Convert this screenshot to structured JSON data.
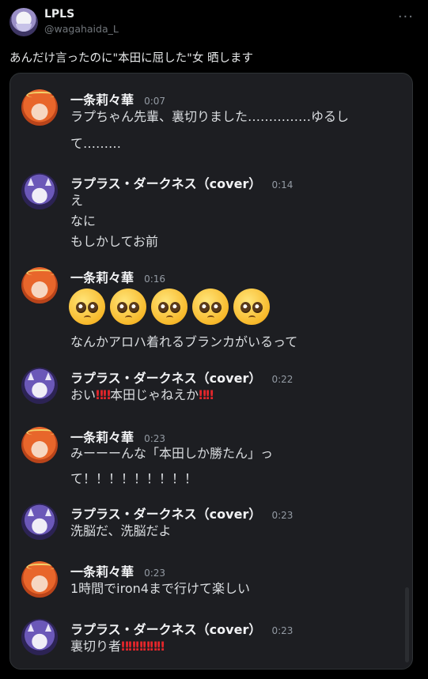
{
  "tweet": {
    "display_name": "LPLS",
    "handle": "@wagahaida_L",
    "text": "あんだけ言ったのに\"本田に屈した\"女 晒します",
    "more_icon": "more-horizontal-icon"
  },
  "chat": {
    "messages": [
      {
        "user": "一条莉々華",
        "time": "0:07",
        "avatar": "ichijou",
        "lines": [
          "ラプちゃん先輩、裏切りました……………ゆるし",
          "て………"
        ]
      },
      {
        "user": "ラプラス・ダークネス（cover）",
        "time": "0:14",
        "avatar": "laplus",
        "lines": [
          "え",
          "なに",
          "もしかしてお前"
        ]
      },
      {
        "user": "一条莉々華",
        "time": "0:16",
        "avatar": "ichijou",
        "emoji": "pleading-face-icon",
        "emoji_count": 5,
        "lines": [
          "なんかアロハ着れるブランカがいるって"
        ]
      },
      {
        "user": "ラプラス・ダークネス（cover）",
        "time": "0:22",
        "avatar": "laplus",
        "text_a": "おい",
        "bang_a": "‼‼",
        "text_b": "本田じゃねえか",
        "bang_b": "‼‼"
      },
      {
        "user": "一条莉々華",
        "time": "0:23",
        "avatar": "ichijou",
        "lines": [
          "みーーーんな「本田しか勝たん」っ",
          "て！！！！！！！！！"
        ]
      },
      {
        "user": "ラプラス・ダークネス（cover）",
        "time": "0:23",
        "avatar": "laplus",
        "lines": [
          "洗脳だ、洗脳だよ"
        ]
      },
      {
        "user": "一条莉々華",
        "time": "0:23",
        "avatar": "ichijou",
        "lines": [
          "1時間でiron4まで行けて楽しい"
        ]
      },
      {
        "user": "ラプラス・ダークネス（cover）",
        "time": "0:23",
        "avatar": "laplus",
        "text_a": "裏切り者",
        "bang_a": "‼‼‼‼‼‼"
      }
    ]
  },
  "colors": {
    "background": "#000000",
    "panel": "#1d1e22",
    "bang_red": "#e5262b"
  }
}
